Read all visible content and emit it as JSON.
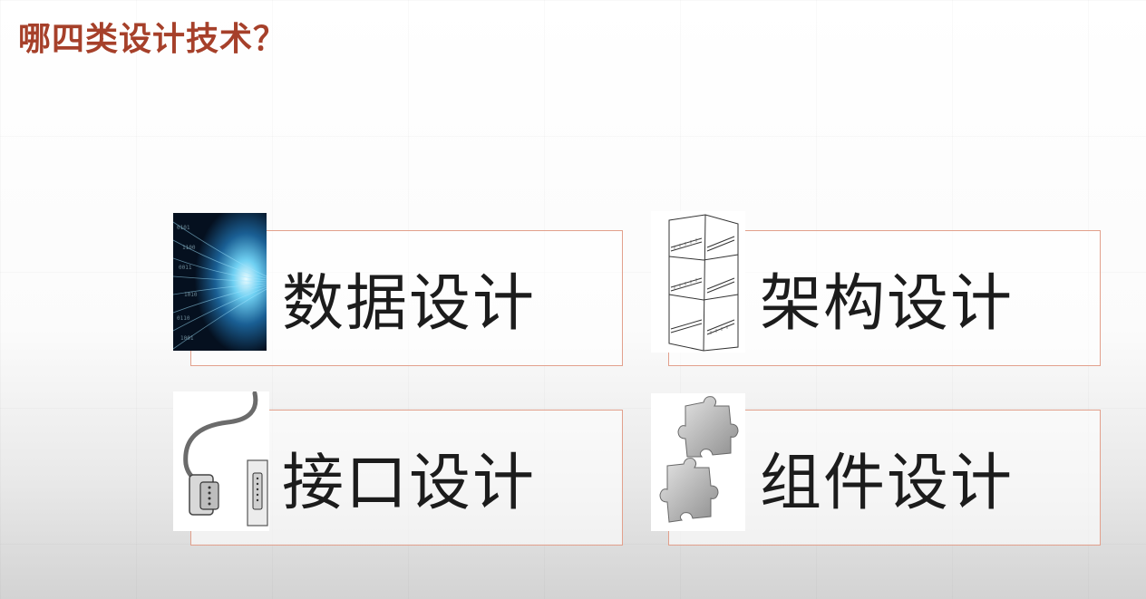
{
  "slide": {
    "title": "哪四类设计技术？",
    "accent_color": "#a6402a",
    "border_color": "#e2a08c"
  },
  "cards": [
    {
      "label": "数据设计",
      "icon": "data-stream-icon"
    },
    {
      "label": "架构设计",
      "icon": "building-sketch-icon"
    },
    {
      "label": "接口设计",
      "icon": "connector-cable-icon"
    },
    {
      "label": "组件设计",
      "icon": "puzzle-pieces-icon"
    }
  ]
}
